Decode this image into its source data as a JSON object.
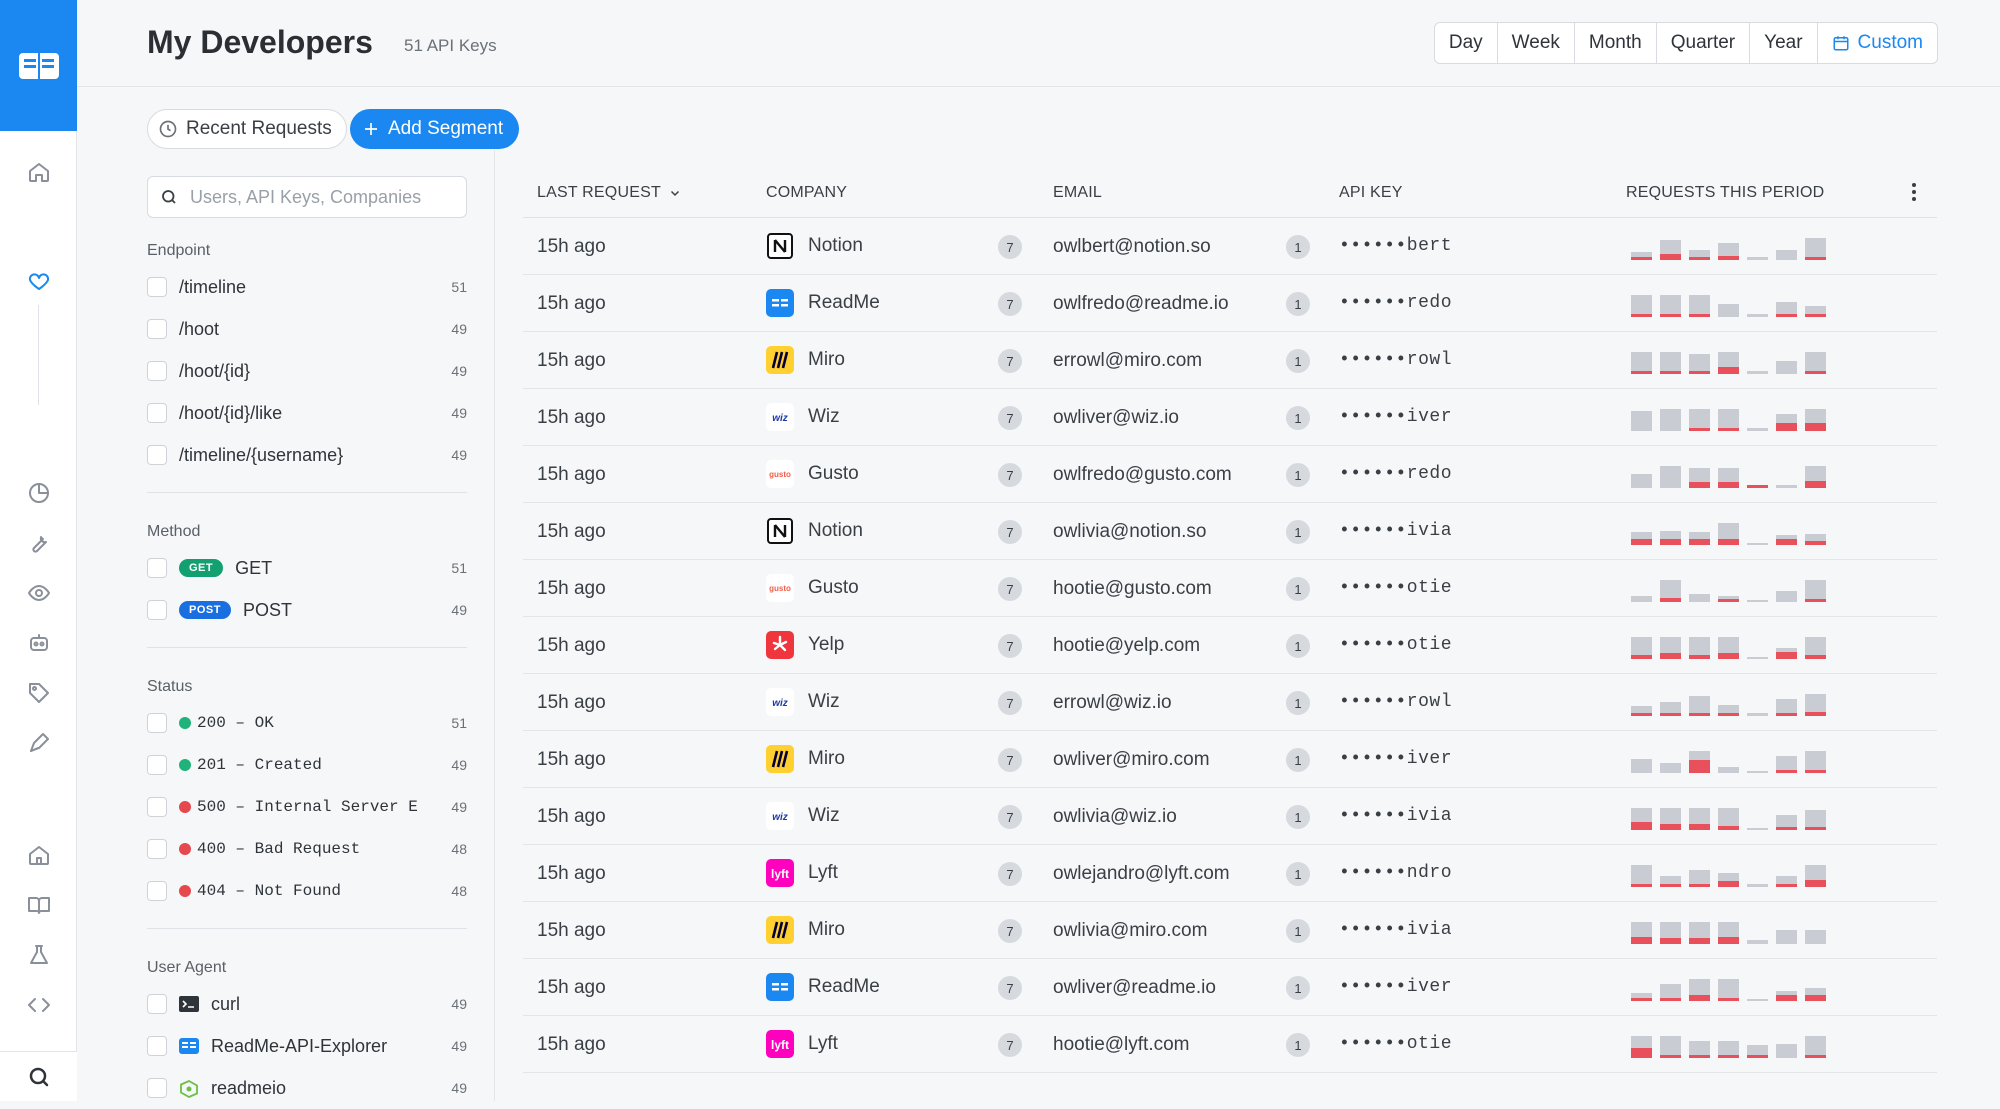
{
  "header": {
    "title": "My Developers",
    "subtitle": "51 API Keys"
  },
  "period": {
    "options": [
      "Day",
      "Week",
      "Month",
      "Quarter",
      "Year",
      "Custom"
    ],
    "active": "Custom"
  },
  "toolbar": {
    "recent_label": "Recent Requests",
    "add_label": "Add Segment"
  },
  "search": {
    "placeholder": "Users, API Keys, Companies"
  },
  "filters": {
    "endpoint": {
      "title": "Endpoint",
      "items": [
        {
          "label": "/timeline",
          "count": "51"
        },
        {
          "label": "/hoot",
          "count": "49"
        },
        {
          "label": "/hoot/{id}",
          "count": "49"
        },
        {
          "label": "/hoot/{id}/like",
          "count": "49"
        },
        {
          "label": "/timeline/{username}",
          "count": "49"
        }
      ]
    },
    "method": {
      "title": "Method",
      "items": [
        {
          "badge": "GET",
          "label": "GET",
          "count": "51",
          "color": "#12a070"
        },
        {
          "badge": "POST",
          "label": "POST",
          "count": "49",
          "color": "#1a6fe0"
        }
      ]
    },
    "status": {
      "title": "Status",
      "items": [
        {
          "label": "200 – OK",
          "count": "51",
          "color": "#1fb27a"
        },
        {
          "label": "201 – Created",
          "count": "49",
          "color": "#1fb27a"
        },
        {
          "label": "500 – Internal Server E",
          "count": "49",
          "color": "#e5484d"
        },
        {
          "label": "400 – Bad Request",
          "count": "48",
          "color": "#e5484d"
        },
        {
          "label": "404 – Not Found",
          "count": "48",
          "color": "#e5484d"
        }
      ]
    },
    "user_agent": {
      "title": "User Agent",
      "items": [
        {
          "label": "curl",
          "count": "49",
          "icon": "terminal-icon"
        },
        {
          "label": "ReadMe-API-Explorer",
          "count": "49",
          "icon": "readme-icon"
        },
        {
          "label": "readmeio",
          "count": "49",
          "icon": "node-icon"
        }
      ]
    }
  },
  "table": {
    "columns": {
      "last_request": "LAST REQUEST",
      "company": "COMPANY",
      "email": "EMAIL",
      "api_key": "API KEY",
      "requests": "REQUESTS THIS PERIOD"
    },
    "rows": [
      {
        "last": "15h ago",
        "company": "Notion",
        "logo": "notion",
        "ccount": "7",
        "email": "owlbert@notion.so",
        "ecount": "1",
        "key": "••••••bert",
        "bars": [
          [
            0.3,
            0.1
          ],
          [
            0.7,
            0.2
          ],
          [
            0.35,
            0.1
          ],
          [
            0.6,
            0.15
          ],
          [
            0.12,
            0
          ],
          [
            0.35,
            0
          ],
          [
            0.8,
            0.1
          ]
        ]
      },
      {
        "last": "15h ago",
        "company": "ReadMe",
        "logo": "readme",
        "ccount": "7",
        "email": "owlfredo@readme.io",
        "ecount": "1",
        "key": "••••••redo",
        "bars": [
          [
            0.8,
            0.1
          ],
          [
            0.8,
            0.1
          ],
          [
            0.8,
            0.1
          ],
          [
            0.45,
            0
          ],
          [
            0.1,
            0
          ],
          [
            0.55,
            0.1
          ],
          [
            0.4,
            0.1
          ]
        ]
      },
      {
        "last": "15h ago",
        "company": "Miro",
        "logo": "miro",
        "ccount": "7",
        "email": "errowl@miro.com",
        "ecount": "1",
        "key": "••••••rowl",
        "bars": [
          [
            0.8,
            0.1
          ],
          [
            0.8,
            0.1
          ],
          [
            0.7,
            0.1
          ],
          [
            0.8,
            0.25
          ],
          [
            0.12,
            0
          ],
          [
            0.45,
            0
          ],
          [
            0.8,
            0.1
          ]
        ]
      },
      {
        "last": "15h ago",
        "company": "Wiz",
        "logo": "wiz",
        "ccount": "7",
        "email": "owliver@wiz.io",
        "ecount": "1",
        "key": "••••••iver",
        "bars": [
          [
            0.7,
            0
          ],
          [
            0.8,
            0
          ],
          [
            0.8,
            0.1
          ],
          [
            0.8,
            0.1
          ],
          [
            0.12,
            0
          ],
          [
            0.6,
            0.3
          ],
          [
            0.8,
            0.3
          ]
        ]
      },
      {
        "last": "15h ago",
        "company": "Gusto",
        "logo": "gusto",
        "ccount": "7",
        "email": "owlfredo@gusto.com",
        "ecount": "1",
        "key": "••••••redo",
        "bars": [
          [
            0.5,
            0
          ],
          [
            0.8,
            0
          ],
          [
            0.7,
            0.2
          ],
          [
            0.7,
            0.2
          ],
          [
            0.1,
            0.1
          ],
          [
            0.1,
            0
          ],
          [
            0.8,
            0.25
          ]
        ]
      },
      {
        "last": "15h ago",
        "company": "Notion",
        "logo": "notion",
        "ccount": "7",
        "email": "owlivia@notion.so",
        "ecount": "1",
        "key": "••••••ivia",
        "bars": [
          [
            0.45,
            0.2
          ],
          [
            0.5,
            0.2
          ],
          [
            0.45,
            0.2
          ],
          [
            0.8,
            0.2
          ],
          [
            0.05,
            0
          ],
          [
            0.35,
            0.2
          ],
          [
            0.4,
            0.15
          ]
        ]
      },
      {
        "last": "15h ago",
        "company": "Gusto",
        "logo": "gusto",
        "ccount": "7",
        "email": "hootie@gusto.com",
        "ecount": "1",
        "key": "••••••otie",
        "bars": [
          [
            0.2,
            0
          ],
          [
            0.8,
            0.15
          ],
          [
            0.3,
            0
          ],
          [
            0.2,
            0.1
          ],
          [
            0.05,
            0
          ],
          [
            0.4,
            0
          ],
          [
            0.8,
            0.1
          ]
        ]
      },
      {
        "last": "15h ago",
        "company": "Yelp",
        "logo": "yelp",
        "ccount": "7",
        "email": "hootie@yelp.com",
        "ecount": "1",
        "key": "••••••otie",
        "bars": [
          [
            0.8,
            0.15
          ],
          [
            0.8,
            0.2
          ],
          [
            0.8,
            0.15
          ],
          [
            0.8,
            0.2
          ],
          [
            0.05,
            0
          ],
          [
            0.4,
            0.25
          ],
          [
            0.8,
            0.15
          ]
        ]
      },
      {
        "last": "15h ago",
        "company": "Wiz",
        "logo": "wiz",
        "ccount": "7",
        "email": "errowl@wiz.io",
        "ecount": "1",
        "key": "••••••rowl",
        "bars": [
          [
            0.35,
            0.1
          ],
          [
            0.5,
            0.1
          ],
          [
            0.7,
            0.1
          ],
          [
            0.4,
            0.1
          ],
          [
            0.1,
            0
          ],
          [
            0.6,
            0.1
          ],
          [
            0.8,
            0.15
          ]
        ]
      },
      {
        "last": "15h ago",
        "company": "Miro",
        "logo": "miro",
        "ccount": "7",
        "email": "owliver@miro.com",
        "ecount": "1",
        "key": "••••••iver",
        "bars": [
          [
            0.5,
            0
          ],
          [
            0.35,
            0
          ],
          [
            0.8,
            0.45
          ],
          [
            0.2,
            0
          ],
          [
            0.05,
            0
          ],
          [
            0.6,
            0.1
          ],
          [
            0.8,
            0.1
          ]
        ]
      },
      {
        "last": "15h ago",
        "company": "Wiz",
        "logo": "wiz",
        "ccount": "7",
        "email": "owlivia@wiz.io",
        "ecount": "1",
        "key": "••••••ivia",
        "bars": [
          [
            0.8,
            0.3
          ],
          [
            0.8,
            0.2
          ],
          [
            0.8,
            0.2
          ],
          [
            0.8,
            0.15
          ],
          [
            0.05,
            0
          ],
          [
            0.55,
            0.1
          ],
          [
            0.7,
            0.1
          ]
        ]
      },
      {
        "last": "15h ago",
        "company": "Lyft",
        "logo": "lyft",
        "ccount": "7",
        "email": "owlejandro@lyft.com",
        "ecount": "1",
        "key": "••••••ndro",
        "bars": [
          [
            0.8,
            0.1
          ],
          [
            0.4,
            0.1
          ],
          [
            0.6,
            0.1
          ],
          [
            0.5,
            0.2
          ],
          [
            0.1,
            0
          ],
          [
            0.4,
            0.1
          ],
          [
            0.8,
            0.25
          ]
        ]
      },
      {
        "last": "15h ago",
        "company": "Miro",
        "logo": "miro",
        "ccount": "7",
        "email": "owlivia@miro.com",
        "ecount": "1",
        "key": "••••••ivia",
        "bars": [
          [
            0.8,
            0.25
          ],
          [
            0.8,
            0.2
          ],
          [
            0.8,
            0.2
          ],
          [
            0.8,
            0.25
          ],
          [
            0.15,
            0
          ],
          [
            0.5,
            0
          ],
          [
            0.5,
            0
          ]
        ]
      },
      {
        "last": "15h ago",
        "company": "ReadMe",
        "logo": "readme",
        "ccount": "7",
        "email": "owliver@readme.io",
        "ecount": "1",
        "key": "••••••iver",
        "bars": [
          [
            0.3,
            0.1
          ],
          [
            0.6,
            0.1
          ],
          [
            0.8,
            0.2
          ],
          [
            0.8,
            0.1
          ],
          [
            0.05,
            0
          ],
          [
            0.35,
            0.2
          ],
          [
            0.45,
            0.2
          ]
        ]
      },
      {
        "last": "15h ago",
        "company": "Lyft",
        "logo": "lyft",
        "ccount": "7",
        "email": "hootie@lyft.com",
        "ecount": "1",
        "key": "••••••otie",
        "bars": [
          [
            0.8,
            0.35
          ],
          [
            0.8,
            0.1
          ],
          [
            0.6,
            0.1
          ],
          [
            0.6,
            0.1
          ],
          [
            0.45,
            0.1
          ],
          [
            0.5,
            0
          ],
          [
            0.8,
            0.1
          ]
        ]
      }
    ]
  },
  "colors": {
    "accent": "#1a88f0",
    "error": "#e8505b",
    "bar": "#c9cdd3"
  }
}
